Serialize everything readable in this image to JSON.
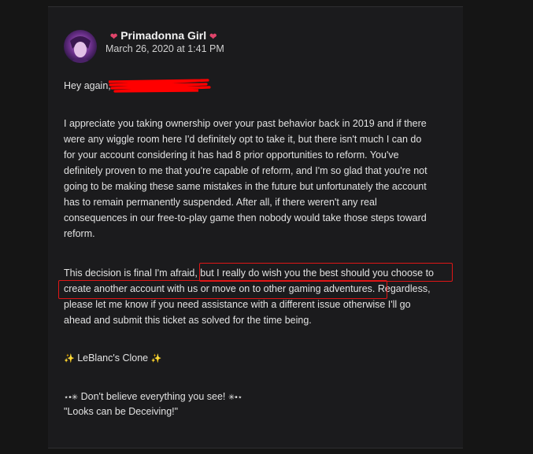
{
  "post": {
    "author": "Primadonna Girl",
    "date": "March 26, 2020 at 1:41 PM",
    "greeting": "Hey again,",
    "paragraph1": [
      "I appreciate you taking ownership over your past behavior back in 2019 and if there",
      "were any wiggle room here I'd definitely opt to take it, but there isn't much I can do",
      "for your account considering it has had 8 prior opportunities to reform. You've",
      "definitely proven to me that you're capable of reform, and I'm so glad that you're not",
      "going to be making these same mistakes in the future but unfortunately the account",
      "has to remain permanently suspended. After all, if there weren't any real",
      "consequences in our free-to-play game then nobody would take those steps toward",
      "reform."
    ],
    "paragraph2": [
      "This decision is final I'm afraid, but I really do wish you the best should you choose to",
      "create another account with us or move on to other gaming adventures. Regardless,",
      "please let me know if you need assistance with a different issue otherwise I'll go",
      "ahead and submit this ticket as solved for the time being."
    ],
    "signature_name": "LeBlanc's Clone",
    "signature_quote_1": "Don't believe everything you see!",
    "signature_quote_2": "\"Looks can be Deceiving!\""
  },
  "colors": {
    "background": "#151515",
    "card": "#1b1b1d",
    "text": "#e2e2e2",
    "accent_heart": "#e0446a",
    "annotation_red": "#e01616",
    "sparkle": "#f5d94e"
  },
  "icons": {
    "heart": "heart-icon",
    "sparkle": "sparkle-icon",
    "star": "star-icon"
  }
}
